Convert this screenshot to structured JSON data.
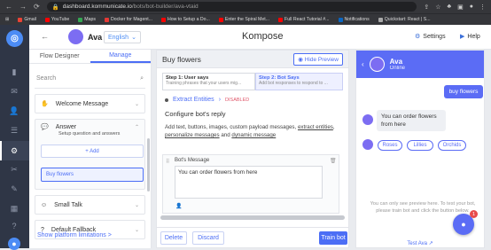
{
  "browser": {
    "url_host": "dashboard.kommunicate.io",
    "url_path": "/bots/bot-builder/ava-vtaid",
    "bookmarks": [
      "Gmail",
      "YouTube",
      "Maps",
      "Docker for Magent...",
      "How to Setup a Do...",
      "Enter the Spiral Met...",
      "Full React Tutorial #...",
      "Notifications",
      "Quickstart: React | S..."
    ]
  },
  "header": {
    "bot_name": "Ava",
    "language": "English",
    "app_title": "Kompose",
    "settings_label": "Settings",
    "help_label": "Help"
  },
  "left_panel": {
    "tabs": [
      "Flow Designer",
      "Manage"
    ],
    "search_placeholder": "Search",
    "items": {
      "welcome": "Welcome Message",
      "answer": "Answer",
      "answer_sub": "Setup question and answers",
      "add": "+ Add",
      "sub_item": "Buy flowers",
      "small_talk": "Small Talk",
      "fallback": "Default Fallback"
    },
    "show_limits": "Show platform limitations >"
  },
  "editor": {
    "title": "Buy flowers",
    "hide_preview": "Hide Preview",
    "step1_title": "Step 1: User says",
    "step1_sub": "Training phrases that your users mig...",
    "step2_title": "Step 2: Bot Says",
    "step2_sub": "Add bot responses to respond to ...",
    "extract_entities": "Extract Entities",
    "disabled": "DISABLED",
    "config_title": "Configure bot's reply",
    "config_desc_1": "Add text, buttons, images, custom payload messages,",
    "config_desc_link1": "extract entities",
    "config_desc_link2": "personalize messages",
    "config_desc_and": "and",
    "config_desc_link3": "dynamic message",
    "bot_message_label": "Bot's Message",
    "bot_message": "You can order flowers from here",
    "delete": "Delete",
    "discard": "Discard",
    "train": "Train bot"
  },
  "preview": {
    "name": "Ava",
    "status": "Online",
    "user_msg": "buy flowers",
    "bot_msg": "You can order flowers from here",
    "chips": [
      "Roses",
      "Lillies",
      "Orchids"
    ],
    "note": "You can only see preview here. To test your bot, please train bot and click the button below.",
    "test_link": "Test Ava",
    "badge": "1"
  },
  "colors": {
    "accent": "#4c6ef5",
    "chat_header": "#5b6cf5",
    "rail": "#2f3646",
    "danger": "#e0586b"
  }
}
